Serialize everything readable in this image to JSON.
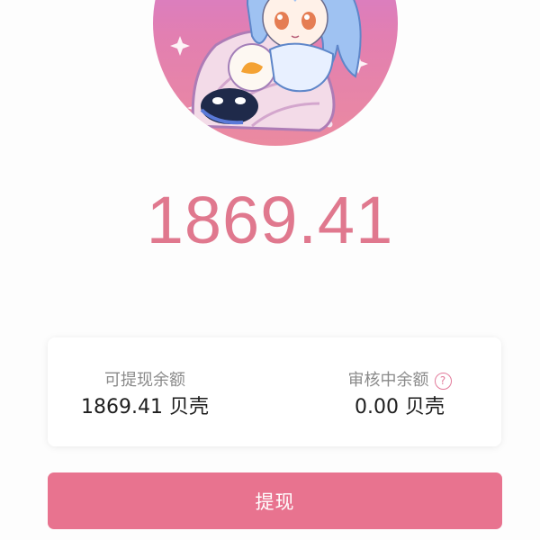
{
  "wallet": {
    "total_balance": "1869.41",
    "withdrawable": {
      "label": "可提现余额",
      "value": "1869.41 贝壳"
    },
    "under_review": {
      "label": "审核中余额",
      "value": "0.00 贝壳",
      "help_icon": "question-circle-icon"
    },
    "withdraw_button": {
      "label": "提现"
    }
  },
  "avatar": {
    "icon": "character-illustration"
  },
  "colors": {
    "accent": "#e8738f",
    "balance_text": "#e0788e",
    "label_text": "#8a8a8a",
    "value_text": "#1e1e1e"
  }
}
